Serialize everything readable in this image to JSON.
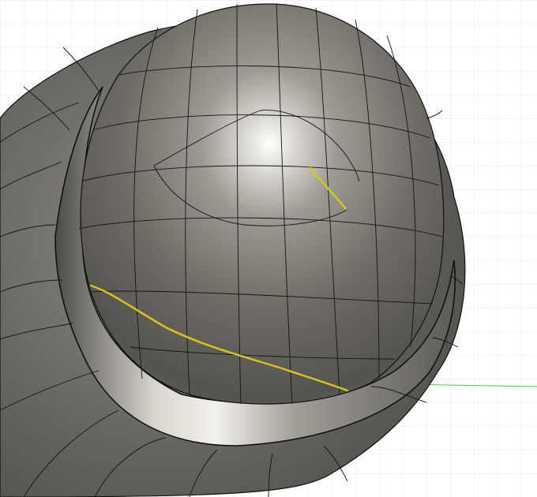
{
  "viewport": {
    "background_color": "#ffffff",
    "grid_minor_color": "#e6e9ee",
    "grid_major_color": "#d2d7de",
    "axis_x_color": "#3fcf3f",
    "axis_y_color": "#e07a7a"
  },
  "model": {
    "kind": "t-spline-hat-body",
    "body_color_dark": "#4a4843",
    "body_color_mid": "#8a8780",
    "body_color_light": "#f4f2ec",
    "edge_color": "#111111",
    "selected_edge_color": "#d6c81c",
    "selected_edges": 2
  }
}
